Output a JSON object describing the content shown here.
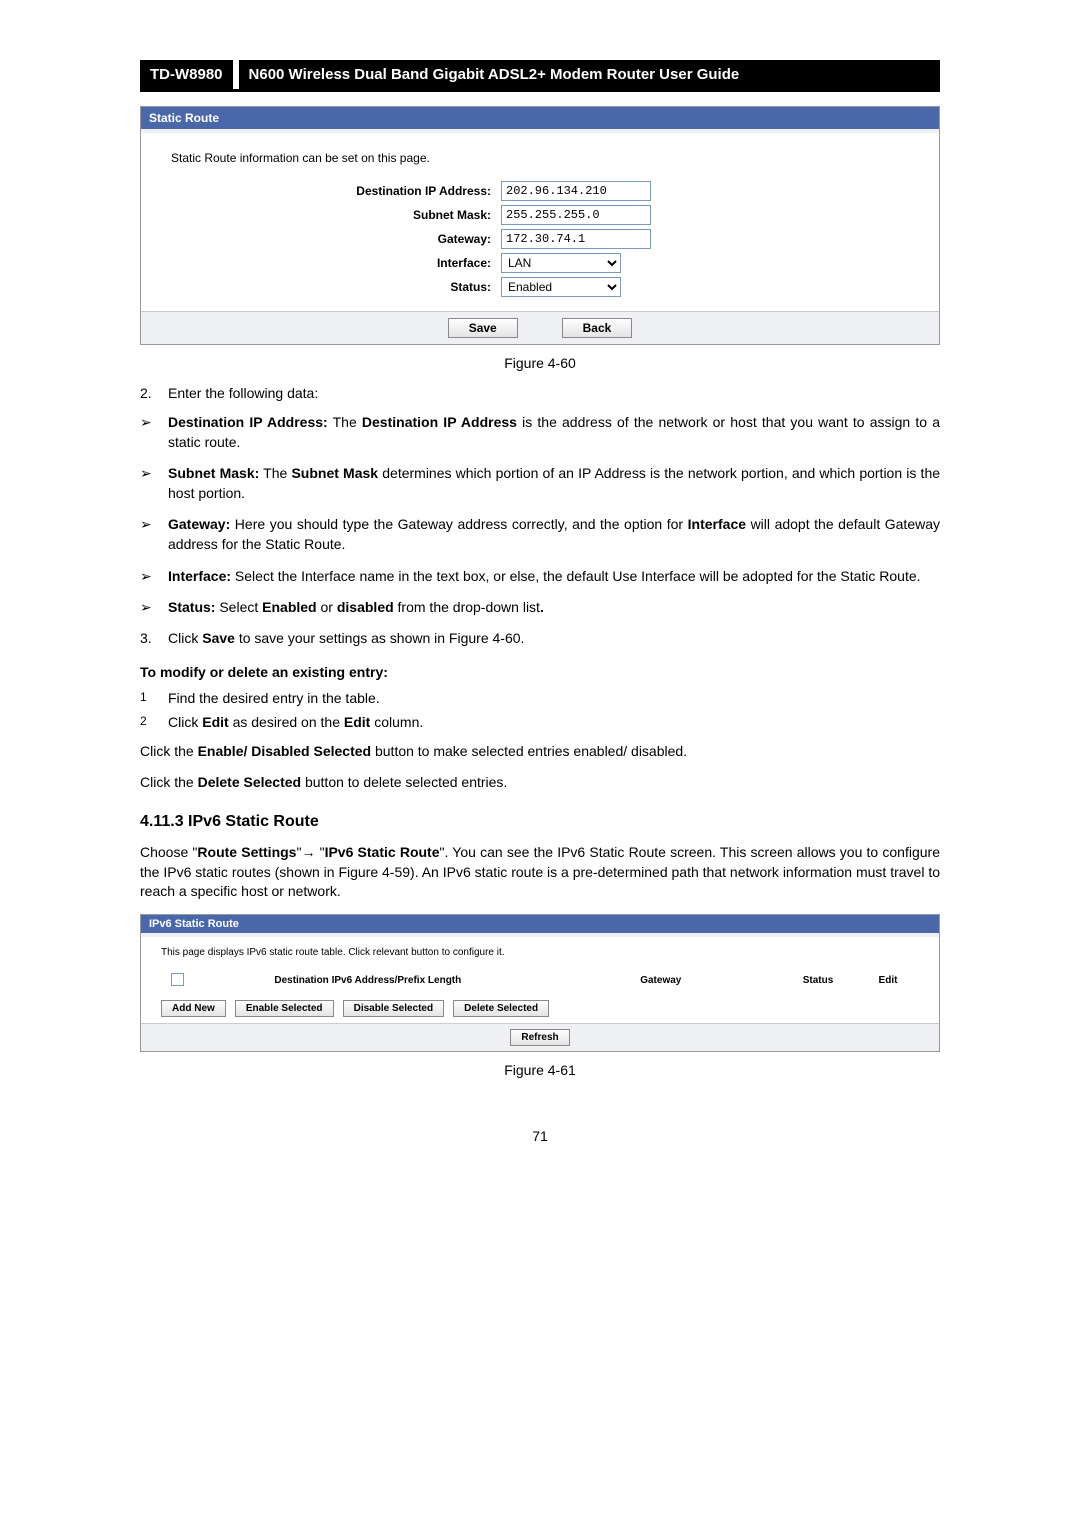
{
  "header": {
    "model": "TD-W8980",
    "title": "N600 Wireless Dual Band Gigabit ADSL2+ Modem Router User Guide"
  },
  "panel1": {
    "title": "Static Route",
    "desc": "Static Route information can be set on this page.",
    "rows": {
      "dest_label": "Destination IP Address:",
      "dest_val": "202.96.134.210",
      "mask_label": "Subnet Mask:",
      "mask_val": "255.255.255.0",
      "gw_label": "Gateway:",
      "gw_val": "172.30.74.1",
      "if_label": "Interface:",
      "if_val": "LAN",
      "status_label": "Status:",
      "status_val": "Enabled"
    },
    "save": "Save",
    "back": "Back"
  },
  "fig60": "Figure 4-60",
  "step2": {
    "num": "2.",
    "text": "Enter the following data:"
  },
  "bullets": {
    "b1": {
      "bold": "Destination IP Address:",
      "rest": " The ",
      "bold2": "Destination IP Address",
      "rest2": " is the address of the network or host that you want to assign to a static route."
    },
    "b2": {
      "bold": "Subnet Mask:",
      "rest": " The ",
      "bold2": "Subnet Mask",
      "rest2": " determines which portion of an IP Address is the network portion, and which portion is the host portion."
    },
    "b3": {
      "bold": "Gateway:",
      "rest": " Here you should type the Gateway address correctly, and the option for ",
      "bold2": "Interface",
      "rest2": " will adopt the default Gateway address for the Static Route."
    },
    "b4": {
      "bold": "Interface:",
      "rest": " Select the Interface name in the text box, or else, the default Use Interface will be adopted for the Static Route."
    },
    "b5": {
      "bold": "Status:",
      "rest": " Select ",
      "bold2": "Enabled",
      "rest2": " or ",
      "bold3": "disabled",
      "rest3": " from the drop-down list",
      "bold4": "."
    }
  },
  "step3": {
    "num": "3.",
    "pre": "Click ",
    "bold": "Save",
    "post": " to save your settings as shown in Figure 4-60."
  },
  "modify_head": "To modify or delete an existing entry:",
  "m1": {
    "num": "1",
    "text": "Find the desired entry in the table."
  },
  "m2": {
    "num": "2",
    "pre": "Click ",
    "b1": "Edit",
    "mid": " as desired on the ",
    "b2": "Edit",
    "post": " column."
  },
  "p1": {
    "pre": "Click the ",
    "b": "Enable/ Disabled Selected",
    "post": " button to make selected entries enabled/ disabled."
  },
  "p2": {
    "pre": "Click the ",
    "b": "Delete Selected",
    "post": " button to delete selected entries."
  },
  "sec_title": "4.11.3 IPv6 Static Route",
  "sec_para": {
    "pre": "Choose \"",
    "b1": "Route Settings",
    "mid1": "\"→ \"",
    "b2": "IPv6 Static Route",
    "post": "\". You can see the IPv6 Static Route screen. This screen allows you to configure the IPv6 static routes (shown in Figure 4-59). An IPv6 static route is a pre-determined path that network information must travel to reach a specific host or network."
  },
  "ipv6": {
    "title": "IPv6 Static Route",
    "desc": "This page displays IPv6 static route table. Click relevant button to configure it.",
    "cols": {
      "c2": "Destination IPv6 Address/Prefix Length",
      "c3": "Gateway",
      "c4": "Status",
      "c5": "Edit"
    },
    "btns": {
      "add": "Add New",
      "enable": "Enable Selected",
      "disable": "Disable Selected",
      "delete": "Delete Selected",
      "refresh": "Refresh"
    }
  },
  "fig61": "Figure 4-61",
  "page_num": "71",
  "arrow_char": "➢"
}
